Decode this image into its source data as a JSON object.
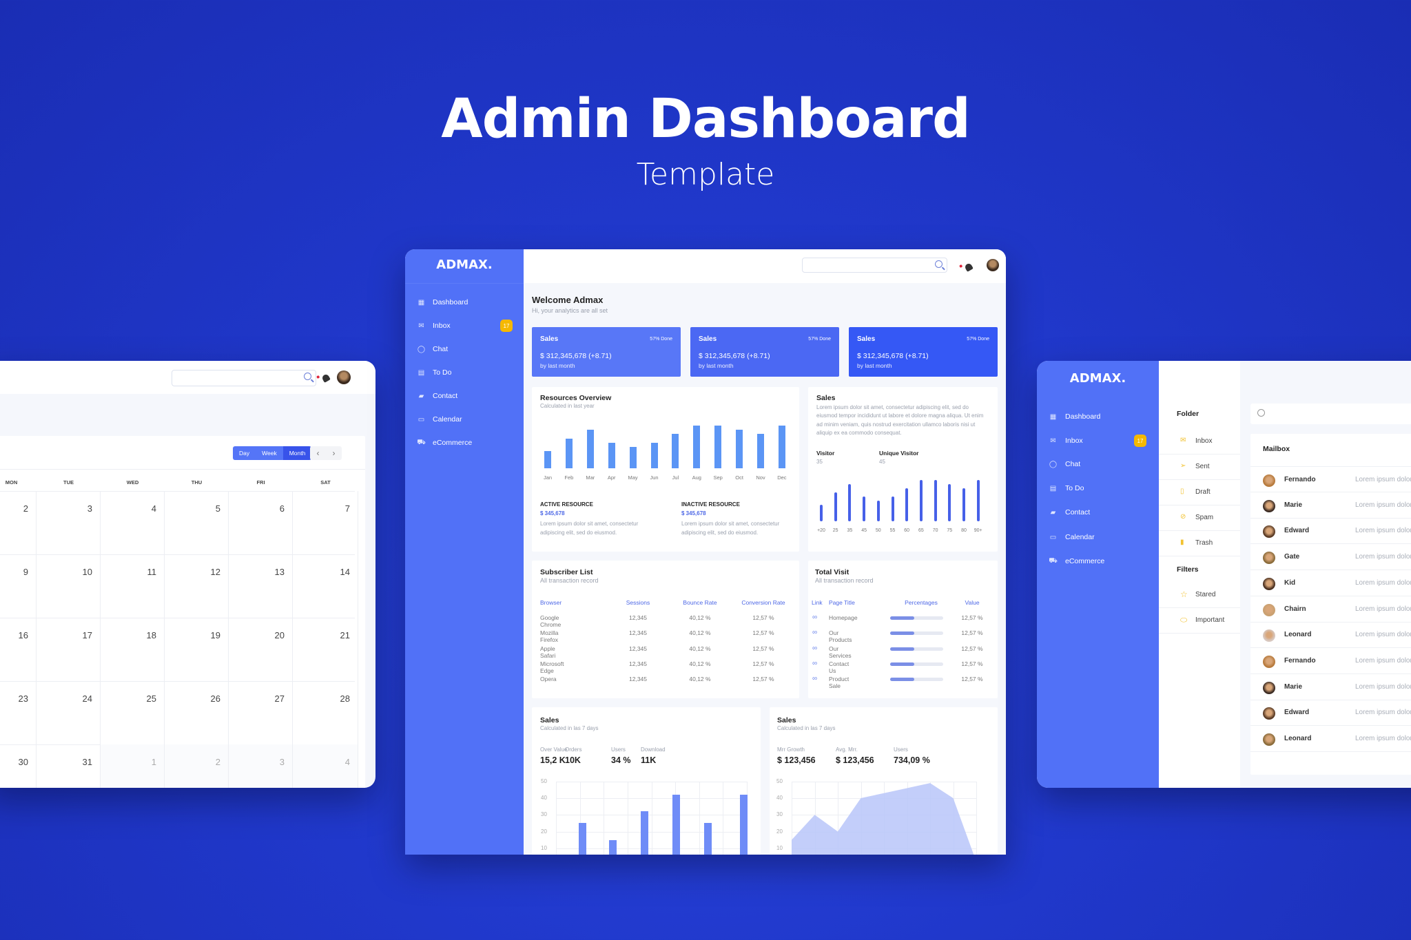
{
  "hero": {
    "title": "Admin Dashboard",
    "subtitle": "Template"
  },
  "brand": "ADMAX.",
  "nav": [
    {
      "label": "Dashboard",
      "icon": "grid-icon"
    },
    {
      "label": "Inbox",
      "icon": "mail-icon"
    },
    {
      "label": "Chat",
      "icon": "chat-icon"
    },
    {
      "label": "To Do",
      "icon": "todo-icon"
    },
    {
      "label": "Contact",
      "icon": "contact-icon"
    },
    {
      "label": "Calendar",
      "icon": "calendar-icon"
    },
    {
      "label": "eCommerce",
      "icon": "cart-icon"
    }
  ],
  "inbox_badge": "17",
  "dashboard": {
    "welcome": "Welcome Admax",
    "welcome_sub": "Hi, your analytics are all set",
    "stat_cards": [
      {
        "title": "Sales",
        "done": "57% Done",
        "value": "$ 312,345,678 (+8.71)",
        "note": "by last month",
        "color": "#5877f7"
      },
      {
        "title": "Sales",
        "done": "57% Done",
        "value": "$ 312,345,678 (+8.71)",
        "note": "by last month",
        "color": "#4b68f3"
      },
      {
        "title": "Sales",
        "done": "57% Done",
        "value": "$ 312,345,678 (+8.71)",
        "note": "by last month",
        "color": "#3558f5"
      }
    ],
    "resources": {
      "title": "Resources Overview",
      "subtitle": "Calculated in last year",
      "active_label": "ACTIVE RESOURCE",
      "active_value": "$ 345,678",
      "active_text": "Lorem ipsum dolor sit amet, consectetur adipiscing elit, sed do eiusmod.",
      "inactive_label": "INACTIVE RESOURCE",
      "inactive_value": "$ 345,678",
      "inactive_text": "Lorem ipsum dolor sit amet, consectetur adipiscing elit, sed do eiusmod."
    },
    "sales_info": {
      "title": "Sales",
      "text": "Lorem ipsum dolor sit amet, consectetur adipiscing elit, sed do eiusmod tempor incididunt ut labore et dolore magna aliqua. Ut enim ad minim veniam, quis nostrud exercitation ullamco laboris nisi ut aliquip ex ea commodo consequat.",
      "visitor_label": "Visitor",
      "visitor_value": "35",
      "unique_label": "Unique Visitor",
      "unique_value": "45"
    },
    "subscriber": {
      "title": "Subscriber List",
      "subtitle": "All transaction record",
      "headers": [
        "Browser",
        "Sessions",
        "Bounce Rate",
        "Conversion Rate"
      ],
      "rows": [
        [
          "Google Chrome",
          "12,345",
          "40,12 %",
          "12,57 %"
        ],
        [
          "Mozilla Firefox",
          "12,345",
          "40,12 %",
          "12,57 %"
        ],
        [
          "Apple Safari",
          "12,345",
          "40,12 %",
          "12,57 %"
        ],
        [
          "Microsoft Edge",
          "12,345",
          "40,12 %",
          "12,57 %"
        ],
        [
          "Opera",
          "12,345",
          "40,12 %",
          "12,57 %"
        ]
      ]
    },
    "total_visit": {
      "title": "Total Visit",
      "subtitle": "All transaction record",
      "headers": [
        "Link",
        "Page Title",
        "Percentages",
        "Value"
      ],
      "rows": [
        {
          "page": "Homepage",
          "percent": 45,
          "value": "12,57 %"
        },
        {
          "page": "Our Products",
          "percent": 45,
          "value": "12,57 %"
        },
        {
          "page": "Our Services",
          "percent": 45,
          "value": "12,57 %"
        },
        {
          "page": "Contact Us",
          "percent": 45,
          "value": "12,57 %"
        },
        {
          "page": "Product Sale",
          "percent": 45,
          "value": "12,57 %"
        }
      ]
    },
    "sales_a": {
      "title": "Sales",
      "subtitle": "Calculated in las 7 days",
      "stats": [
        {
          "label": "Over Value",
          "value": "15,2 K"
        },
        {
          "label": "Orders",
          "value": "10K"
        },
        {
          "label": "Users",
          "value": "34 %"
        },
        {
          "label": "Download",
          "value": "11K"
        }
      ]
    },
    "sales_b": {
      "title": "Sales",
      "subtitle": "Calculated in las 7 days",
      "stats": [
        {
          "label": "Mrr Growth",
          "value": "$ 123,456"
        },
        {
          "label": "Avg. Mrr.",
          "value": "$ 123,456"
        },
        {
          "label": "Users",
          "value": "734,09 %"
        }
      ]
    }
  },
  "calendar": {
    "views": [
      "Day",
      "Week",
      "Month"
    ],
    "active_view": "Month",
    "prev": "‹",
    "next": "›",
    "weekdays": [
      "MON",
      "TUE",
      "WED",
      "THU",
      "FRI",
      "SAT"
    ],
    "weeks": [
      [
        "2",
        "3",
        "4",
        "5",
        "6",
        "7"
      ],
      [
        "9",
        "10",
        "11",
        "12",
        "13",
        "14"
      ],
      [
        "16",
        "17",
        "18",
        "19",
        "20",
        "21"
      ],
      [
        "23",
        "24",
        "25",
        "26",
        "27",
        "28"
      ],
      [
        "30",
        "31",
        "1",
        "2",
        "3",
        "4"
      ]
    ],
    "other_month_from": 2
  },
  "mail": {
    "folder_heading": "Folder",
    "folders": [
      {
        "label": "Inbox",
        "icon": "mail-icon"
      },
      {
        "label": "Sent",
        "icon": "send-icon"
      },
      {
        "label": "Draft",
        "icon": "draft-icon"
      },
      {
        "label": "Spam",
        "icon": "spam-icon"
      },
      {
        "label": "Trash",
        "icon": "trash-icon"
      }
    ],
    "filters_heading": "Filters",
    "filters": [
      {
        "label": "Stared",
        "icon": "star-icon"
      },
      {
        "label": "Important",
        "icon": "label-icon"
      }
    ],
    "mailbox_title": "Mailbox",
    "messages": [
      {
        "name": "Fernando",
        "preview": "Lorem ipsum dolor"
      },
      {
        "name": "Marie",
        "preview": "Lorem ipsum dolor"
      },
      {
        "name": "Edward",
        "preview": "Lorem ipsum dolor"
      },
      {
        "name": "Gate",
        "preview": "Lorem ipsum dolor"
      },
      {
        "name": "Kid",
        "preview": "Lorem ipsum dolor"
      },
      {
        "name": "Chairn",
        "preview": "Lorem ipsum dolor"
      },
      {
        "name": "Leonard",
        "preview": "Lorem ipsum dolor"
      },
      {
        "name": "Fernando",
        "preview": "Lorem ipsum dolor"
      },
      {
        "name": "Marie",
        "preview": "Lorem ipsum dolor"
      },
      {
        "name": "Edward",
        "preview": "Lorem ipsum dolor"
      },
      {
        "name": "Leonard",
        "preview": "Lorem ipsum dolor"
      }
    ]
  },
  "colors": {
    "sidebar": "#5171f7",
    "accent": "#4e68e6",
    "badge": "#f5b800",
    "bar": "#5b95f5",
    "bar_dark": "#4660e8"
  },
  "chart_data": [
    {
      "type": "bar",
      "categories": [
        "Jan",
        "Feb",
        "Mar",
        "Apr",
        "May",
        "Jun",
        "Jul",
        "Aug",
        "Sep",
        "Oct",
        "Nov",
        "Dec"
      ],
      "values": [
        4,
        7,
        9,
        6,
        5,
        6,
        8,
        10,
        10,
        9,
        8,
        10
      ]
    },
    {
      "type": "bar",
      "categories": [
        "+20",
        "25",
        "35",
        "45",
        "50",
        "55",
        "60",
        "65",
        "70",
        "75",
        "80",
        "90+"
      ],
      "values": [
        4,
        7,
        9,
        6,
        5,
        6,
        8,
        10,
        10,
        9,
        8,
        10
      ]
    },
    {
      "type": "bar",
      "yticks": [
        10,
        20,
        30,
        40,
        50
      ],
      "ylim": [
        0,
        50
      ],
      "grid": true,
      "values": [
        25,
        15,
        32,
        42,
        25,
        42
      ]
    },
    {
      "type": "area",
      "yticks": [
        10,
        20,
        30,
        40,
        50
      ],
      "ylim": [
        0,
        50
      ],
      "grid": true,
      "x": [
        0,
        1,
        2,
        3,
        4,
        5,
        6,
        7,
        8
      ],
      "values": [
        15,
        30,
        20,
        40,
        43,
        46,
        49,
        40,
        2
      ]
    }
  ]
}
